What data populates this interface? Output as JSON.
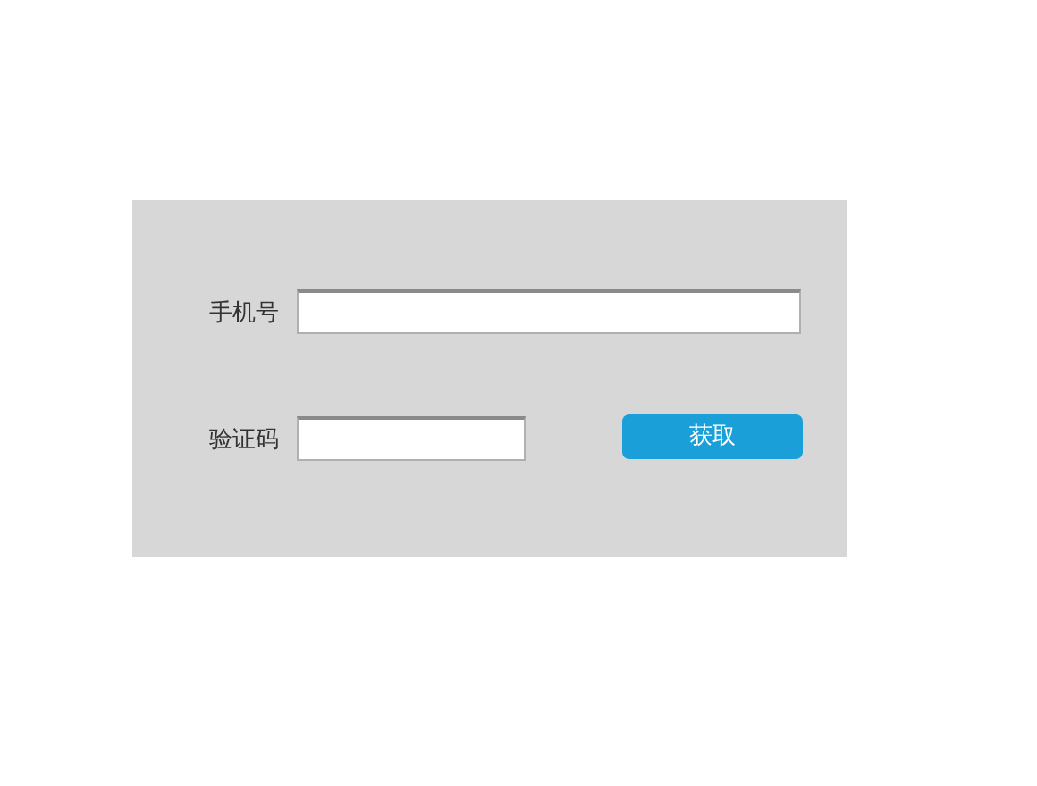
{
  "form": {
    "phone": {
      "label": "手机号"
    },
    "code": {
      "label": "验证码"
    },
    "get_code_button": "获取"
  }
}
